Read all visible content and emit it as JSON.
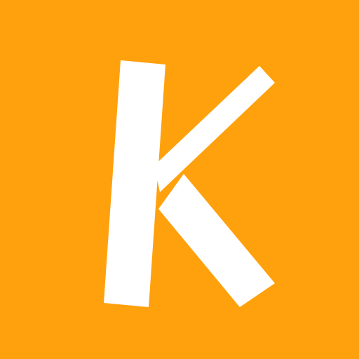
{
  "icon": {
    "logo_letter": "K",
    "background_color": "#ffa10d",
    "glyph_color": "#ffffff"
  }
}
